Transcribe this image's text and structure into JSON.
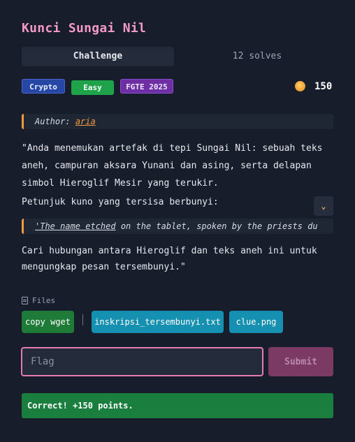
{
  "challenge": {
    "title": "Kunci Sungai Nil",
    "tabs": {
      "challenge": "Challenge",
      "solves": "12 solves"
    },
    "tags": [
      "Crypto",
      "Easy",
      "FGTE 2025"
    ],
    "points": "150",
    "author_label": "Author:",
    "author_name": "aria",
    "description": {
      "line1": "\"Anda menemukan artefak di tepi Sungai Nil: sebuah teks",
      "line2": "aneh, campuran aksara Yunani dan asing, serta delapan",
      "line3": "simbol Hieroglif Mesir yang terukir.",
      "hint_intro": "Petunjuk kuno yang tersisa berbunyi:",
      "quote_underlined": "'The name etched",
      "quote_rest": " on the tablet, spoken by the priests du",
      "outro1": "Cari hubungan antara Hieroglif dan teks aneh ini untuk",
      "outro2": "mengungkap pesan tersembunyi.\""
    },
    "files_label": "Files",
    "files": [
      "copy wget",
      "inskripsi_tersembunyi.txt",
      "clue.png"
    ],
    "flag_placeholder": "Flag",
    "submit_label": "Submit",
    "result": "Correct! +150 points."
  },
  "colors": {
    "title": "#f39ac7",
    "accent": "#f29a3f",
    "success": "#1a7e3e",
    "file_button": "#1690b0"
  }
}
